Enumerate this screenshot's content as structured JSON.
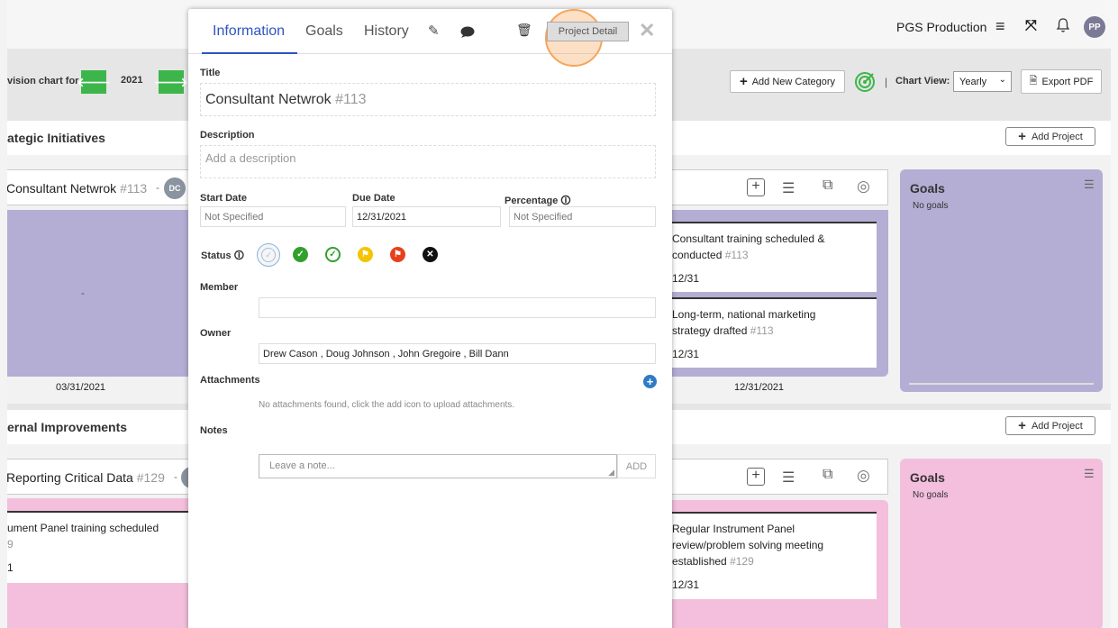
{
  "header": {
    "org_name": "PGS Production",
    "avatar_initials": "PP"
  },
  "toolbar": {
    "chart_for_label": "vision chart for",
    "year": "2021",
    "add_category_label": "Add New Category",
    "chart_view_label": "Chart View:",
    "chart_view_value": "Yearly",
    "export_label": "Export PDF"
  },
  "categories": [
    {
      "title": "ategic Initiatives",
      "add_project_label": "Add Project",
      "project_title": "Consultant Netwrok",
      "project_num": "#113",
      "project_badge": "DC",
      "left_panel_value": "-",
      "left_date": "03/31/2021",
      "right_date": "12/31/2021",
      "tasks": [
        {
          "title_line1": "Consultant training scheduled &",
          "title_line2": "conducted",
          "num": "#113",
          "date": "12/31"
        },
        {
          "title_line1": "Long-term, national marketing",
          "title_line2": "strategy drafted",
          "num": "#113",
          "date": "12/31"
        }
      ],
      "goals_title": "Goals",
      "goals_empty": "No goals"
    },
    {
      "title": "ernal Improvements",
      "add_project_label": "Add Project",
      "project_title": "Reporting Critical Data",
      "project_num": "#129",
      "left_task_line1": "ument Panel training scheduled",
      "left_task_line2": "9",
      "left_task_line3": "1",
      "tasks": [
        {
          "title_line1": "Regular Instrument Panel",
          "title_line2": "review/problem solving meeting",
          "title_line3": "established",
          "num": "#129",
          "date": "12/31"
        }
      ],
      "goals_title": "Goals",
      "goals_empty": "No goals"
    }
  ],
  "modal": {
    "tabs": [
      "Information",
      "Goals",
      "History"
    ],
    "project_detail_label": "Project Detail",
    "title_label": "Title",
    "title_value": "Consultant Netwrok",
    "title_num": "#113",
    "description_label": "Description",
    "description_placeholder": "Add a description",
    "start_date_label": "Start Date",
    "start_date_value": "Not Specified",
    "due_date_label": "Due Date",
    "due_date_value": "12/31/2021",
    "percentage_label": "Percentage",
    "percentage_value": "Not Specified",
    "status_label": "Status",
    "member_label": "Member",
    "owner_label": "Owner",
    "owner_value": "Drew Cason , Doug Johnson , John Gregoire , Bill Dann",
    "attachments_label": "Attachments",
    "attachments_empty": "No attachments found, click the add icon to upload attachments.",
    "notes_label": "Notes",
    "note_placeholder": "Leave a note...",
    "add_note_label": "ADD"
  },
  "colors": {
    "purple_panel": "#b4aed4",
    "pink_panel": "#f3bfdc",
    "active_tab": "#2f54c1",
    "green_button": "#3cb64a",
    "highlight_ring": "#f5a55a"
  }
}
